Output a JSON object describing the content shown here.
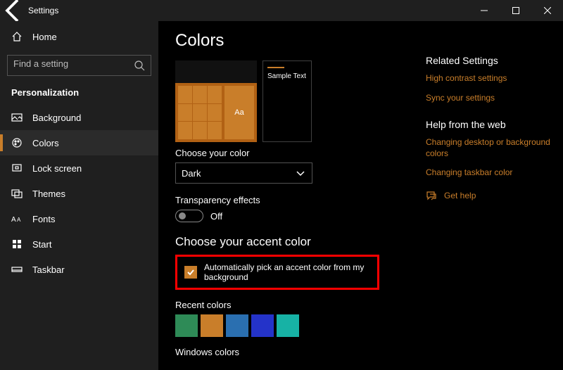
{
  "titlebar": {
    "title": "Settings"
  },
  "sidebar": {
    "home": "Home",
    "search_placeholder": "Find a setting",
    "category": "Personalization",
    "items": [
      {
        "label": "Background"
      },
      {
        "label": "Colors"
      },
      {
        "label": "Lock screen"
      },
      {
        "label": "Themes"
      },
      {
        "label": "Fonts"
      },
      {
        "label": "Start"
      },
      {
        "label": "Taskbar"
      }
    ]
  },
  "page": {
    "title": "Colors",
    "preview_sample_text": "Sample Text",
    "preview_aa": "Aa",
    "choose_color_label": "Choose your color",
    "choose_color_value": "Dark",
    "transparency_label": "Transparency effects",
    "transparency_value": "Off",
    "accent_heading": "Choose your accent color",
    "auto_accent_label": "Automatically pick an accent color from my background",
    "recent_colors_label": "Recent colors",
    "recent_colors": [
      "#2e8b57",
      "#c97e2a",
      "#2a6fb0",
      "#2433c9",
      "#17b2a5"
    ],
    "windows_colors_label": "Windows colors"
  },
  "right": {
    "related_heading": "Related Settings",
    "links_related": [
      "High contrast settings",
      "Sync your settings"
    ],
    "help_heading": "Help from the web",
    "links_help": [
      "Changing desktop or background colors",
      "Changing taskbar color"
    ],
    "get_help": "Get help"
  }
}
